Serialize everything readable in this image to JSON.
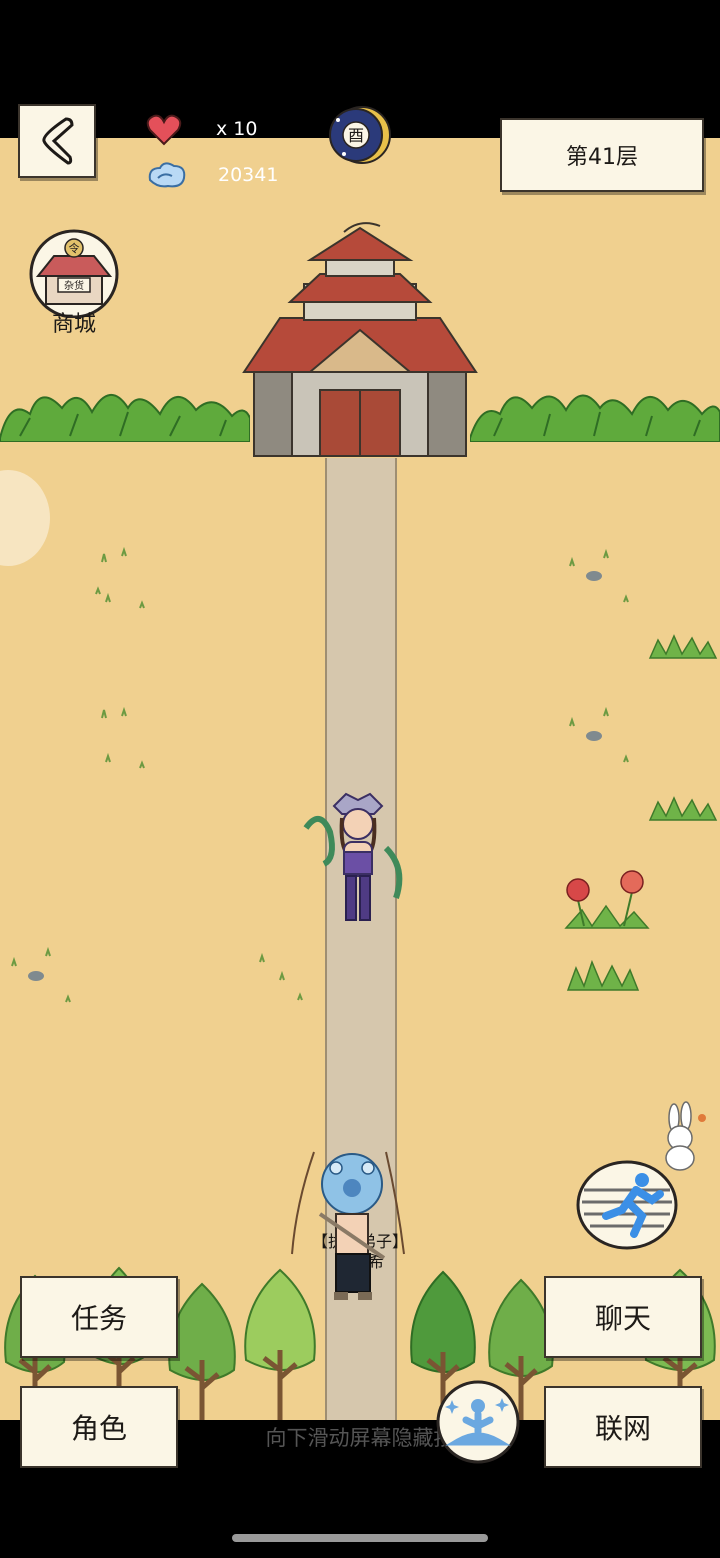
{
  "hud": {
    "lives_label": "x 10",
    "currency_value": "20341",
    "time_glyph": "酉",
    "floor_label": "第41层"
  },
  "shop": {
    "label": "商城",
    "sign_text": "杂货",
    "token_text": "令"
  },
  "npc": {
    "title": "【执剑弟子】",
    "name": "陈冠希"
  },
  "buttons": {
    "tasks": "任务",
    "chat": "聊天",
    "character": "角色",
    "network": "联网"
  },
  "hint": "向下滑动屏幕隐藏按",
  "icons": {
    "back": "back-arrow-icon",
    "lives": "heart-icon",
    "currency": "spirit-cloud-icon",
    "time": "moon-clock-icon",
    "run": "running-man-icon",
    "meditate": "meditation-icon"
  },
  "colors": {
    "ground": "#f0d08f",
    "path": "#d6c7ad",
    "roof": "#b64a3a",
    "panel": "#fbf6e6",
    "leaf": "#5faa3c"
  }
}
